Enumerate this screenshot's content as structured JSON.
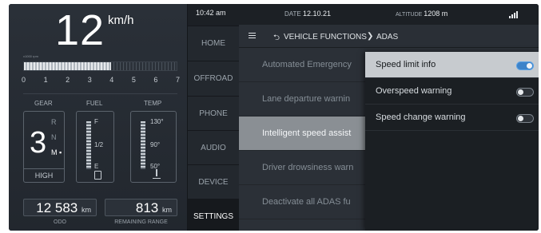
{
  "cluster": {
    "speed": "12",
    "speed_unit": "km/h",
    "rpm_unit": "x1000 rpm",
    "rpm_level": 0.57,
    "rpm_ticks": [
      "0",
      "1",
      "2",
      "3",
      "4",
      "5",
      "6",
      "7"
    ],
    "gear": {
      "label": "GEAR",
      "current": "3",
      "options": [
        "R",
        "N",
        "M"
      ],
      "selected_option": "M",
      "mode": "HIGH"
    },
    "fuel": {
      "label": "FUEL",
      "scale": [
        "F",
        "1/2",
        "E"
      ],
      "icon": "fuel-pump-icon"
    },
    "temp": {
      "label": "TEMP",
      "scale": [
        "130°",
        "90°",
        "50°"
      ],
      "icon": "coolant-temp-icon"
    },
    "odo": {
      "value": "12 583",
      "unit": "km",
      "label": "ODO"
    },
    "range": {
      "value": "813",
      "unit": "km",
      "label": "REMAINING RANGE"
    }
  },
  "status": {
    "time": "10:42 am",
    "date_label": "DATE",
    "date": "12.10.21",
    "altitude_label": "ALTITUDE",
    "altitude": "1208 m",
    "signal_icon": "signal-bars-icon"
  },
  "nav": {
    "items": [
      "HOME",
      "OFFROAD",
      "PHONE",
      "AUDIO",
      "DEVICE",
      "SETTINGS"
    ],
    "active": "SETTINGS"
  },
  "header": {
    "menu_icon": "hamburger-icon",
    "back_icon": "back-arrow-icon",
    "crumb1": "VEHICLE FUNCTIONS",
    "separator": "❯",
    "crumb2": "ADAS"
  },
  "list": {
    "items": [
      "Automated Emergency",
      "Lane departure warnin",
      "Intelligent speed assist",
      "Driver drowsiness warn",
      "Deactivate all ADAS fu"
    ],
    "selected_index": 2
  },
  "dropdown": {
    "items": [
      {
        "label": "Speed limit info",
        "on": true
      },
      {
        "label": "Overspeed warning",
        "on": false
      },
      {
        "label": "Speed change warning",
        "on": false
      }
    ],
    "highlighted_index": 0
  }
}
